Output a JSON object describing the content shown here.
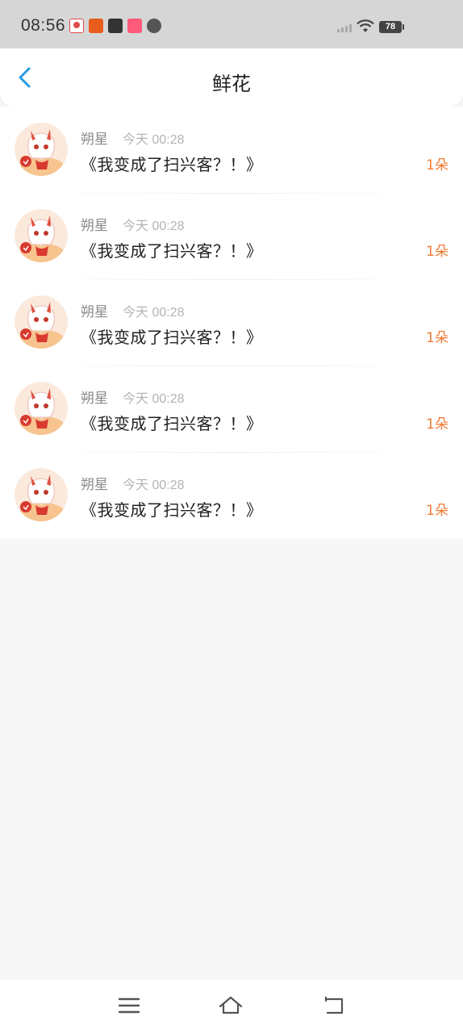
{
  "status_bar": {
    "time": "08:56",
    "battery": "78",
    "notification_icons": [
      "app-notification-icon",
      "app-notification-icon",
      "app-notification-icon",
      "app-notification-icon",
      "chat-icon"
    ]
  },
  "header": {
    "title": "鲜花",
    "back_icon": "chevron-left-icon"
  },
  "colors": {
    "accent": "#2a9bdf",
    "count": "#f07a33"
  },
  "flowers": [
    {
      "user": "朔星",
      "time": "今天 00:28",
      "title": "《我变成了扫兴客？！》",
      "count": "1朵"
    },
    {
      "user": "朔星",
      "time": "今天 00:28",
      "title": "《我变成了扫兴客？！》",
      "count": "1朵"
    },
    {
      "user": "朔星",
      "time": "今天 00:28",
      "title": "《我变成了扫兴客？！》",
      "count": "1朵"
    },
    {
      "user": "朔星",
      "time": "今天 00:28",
      "title": "《我变成了扫兴客？！》",
      "count": "1朵"
    },
    {
      "user": "朔星",
      "time": "今天 00:28",
      "title": "《我变成了扫兴客？！》",
      "count": "1朵"
    }
  ],
  "nav": {
    "menu_icon": "menu-icon",
    "home_icon": "home-icon",
    "back_icon": "back-icon"
  }
}
